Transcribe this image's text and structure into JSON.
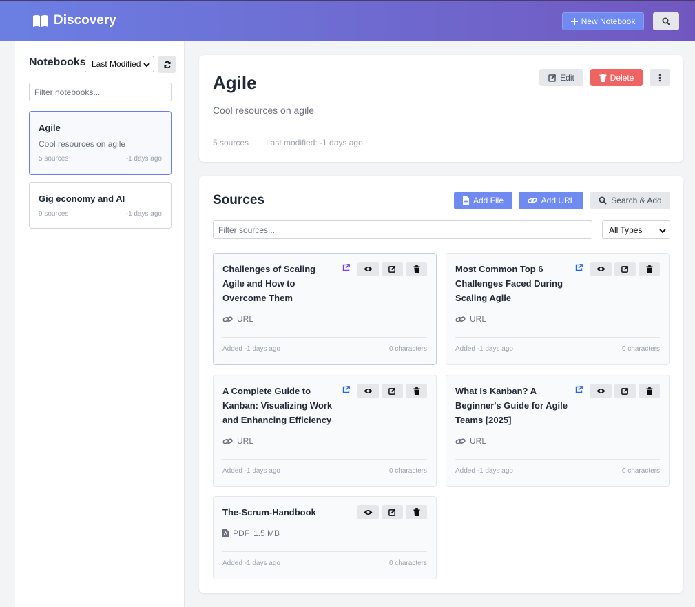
{
  "header": {
    "brand": "Discovery",
    "new_notebook": "New Notebook"
  },
  "sidebar": {
    "title": "Notebooks",
    "sort_value": "Last Modified",
    "filter_placeholder": "Filter notebooks...",
    "notebooks": [
      {
        "name": "Agile",
        "description": "Cool resources on agile",
        "count": "5 sources",
        "modified": "-1 days ago",
        "active": true
      },
      {
        "name": "Gig economy and AI",
        "description": "",
        "count": "9 sources",
        "modified": "-1 days ago",
        "active": false
      }
    ]
  },
  "notebook": {
    "title": "Agile",
    "description": "Cool resources on agile",
    "source_count": "5 sources",
    "last_modified": "Last modified: -1 days ago",
    "edit_label": "Edit",
    "delete_label": "Delete"
  },
  "sources": {
    "title": "Sources",
    "add_file": "Add File",
    "add_url": "Add URL",
    "search_add": "Search & Add",
    "filter_placeholder": "Filter sources...",
    "type_filter": "All Types",
    "items": [
      {
        "title": "Challenges of Scaling Agile and How to Overcome Them",
        "type": "URL",
        "added": "Added -1 days ago",
        "chars": "0 characters"
      },
      {
        "title": "Most Common Top 6 Challenges Faced During Scaling Agile",
        "type": "URL",
        "added": "Added -1 days ago",
        "chars": "0 characters"
      },
      {
        "title": "A Complete Guide to Kanban: Visualizing Work and Enhancing Efficiency",
        "type": "URL",
        "added": "Added -1 days ago",
        "chars": "0 characters"
      },
      {
        "title": "What Is Kanban? A Beginner's Guide for Agile Teams [2025]",
        "type": "URL",
        "added": "Added -1 days ago",
        "chars": "0 characters"
      },
      {
        "title": "The-Scrum-Handbook",
        "type": "PDF",
        "size": "1.5 MB",
        "added": "Added -1 days ago",
        "chars": "0 characters"
      }
    ]
  },
  "colors": {
    "header_start": "#6b7fe3",
    "header_end": "#7158bf",
    "primary_button": "#6f8bf2",
    "danger_button": "#f06363"
  }
}
